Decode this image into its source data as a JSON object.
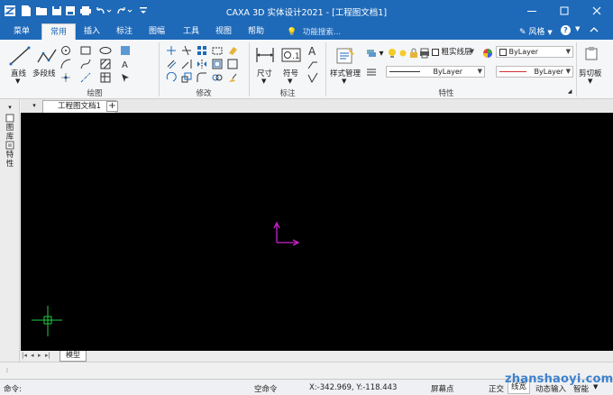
{
  "window": {
    "title": "CAXA 3D 实体设计2021 - [工程图文档1]"
  },
  "ribbon_tabs": [
    "菜单",
    "常用",
    "插入",
    "标注",
    "图幅",
    "工具",
    "视图",
    "帮助"
  ],
  "active_tab": "常用",
  "search_placeholder": "功能搜索...",
  "style_label": "风格",
  "groups": {
    "draw": {
      "label": "绘图",
      "line": "直线",
      "polyline": "多段线"
    },
    "modify": {
      "label": "修改"
    },
    "dimension": {
      "label": "标注",
      "dim": "尺寸",
      "symbol": "符号"
    },
    "properties": {
      "label": "特性",
      "style_mgr": "样式管理",
      "layer": "粗实线层",
      "color": "ByLayer",
      "linetype": "ByLayer",
      "lineweight": "ByLayer"
    },
    "clipboard": {
      "label": "剪切板"
    }
  },
  "document_tab": "工程图文档1",
  "left_panel": {
    "layers": "图库",
    "properties": "特性"
  },
  "model_tab": "模型",
  "status": {
    "command_label": "命令:",
    "empty_command": "空命令",
    "coords": "X:-342.969, Y:-118.443",
    "snap_mode": "屏幕点",
    "ortho": "正交",
    "linewidth": "线宽",
    "dynamic_input": "动态输入",
    "smart": "智能"
  },
  "watermark": "zhanshaoyi.com",
  "colors": {
    "accent": "#1e69b8",
    "canvas": "#000000",
    "ucs": "#cc22cc",
    "cursor": "#22cc44"
  }
}
